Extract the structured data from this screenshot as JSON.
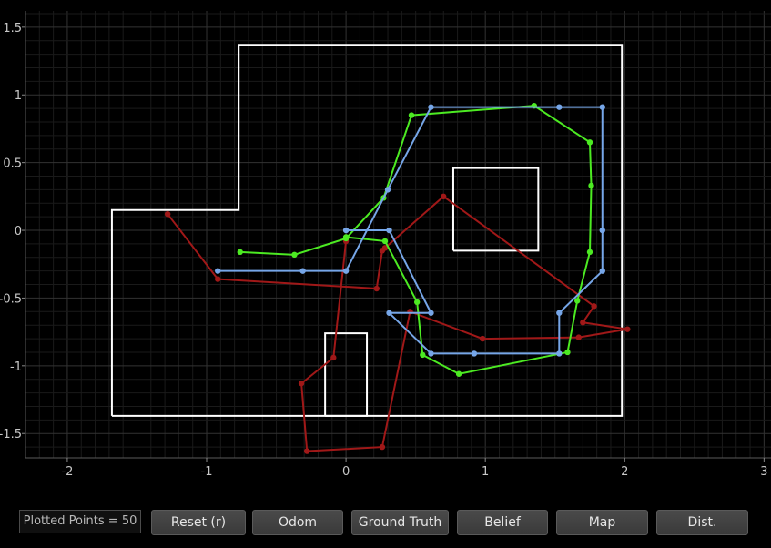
{
  "colors": {
    "background": "#000000",
    "grid_minor": "#1a1a1a",
    "grid_major": "#333333",
    "tick_text": "#c8c8c8",
    "map": "#ffffff",
    "odom": "#a01818",
    "ground_truth": "#4cea22",
    "belief": "#76a6e8"
  },
  "chart_data": {
    "type": "scatter",
    "xlim": [
      -2.3,
      3.05
    ],
    "ylim": [
      -1.68,
      1.62
    ],
    "x_ticks": [
      -2,
      -1,
      0,
      1,
      2,
      3
    ],
    "y_ticks": [
      1.5,
      1,
      0.5,
      0,
      -0.5,
      -1,
      -1.5
    ],
    "grid": true,
    "map_outline": [
      [
        [
          -1.68,
          -1.37
        ],
        [
          1.98,
          -1.37
        ],
        [
          1.98,
          1.37
        ],
        [
          -0.77,
          1.37
        ],
        [
          -0.77,
          0.15
        ],
        [
          -1.68,
          0.15
        ],
        [
          -1.68,
          -1.37
        ]
      ],
      [
        [
          0.77,
          -0.15
        ],
        [
          1.38,
          -0.15
        ],
        [
          1.38,
          0.46
        ],
        [
          0.77,
          0.46
        ],
        [
          0.77,
          -0.15
        ]
      ],
      [
        [
          -0.15,
          -1.37
        ],
        [
          0.15,
          -1.37
        ],
        [
          0.15,
          -0.76
        ],
        [
          -0.15,
          -0.76
        ],
        [
          -0.15,
          -1.37
        ]
      ]
    ],
    "series": [
      {
        "key": "odom",
        "points": [
          [
            -1.28,
            0.12
          ],
          [
            -0.92,
            -0.36
          ],
          [
            0.22,
            -0.43
          ],
          [
            0.26,
            -0.15
          ],
          [
            0.28,
            -0.13
          ],
          [
            0.7,
            0.25
          ],
          [
            1.78,
            -0.56
          ],
          [
            1.7,
            -0.68
          ],
          [
            2.02,
            -0.73
          ],
          [
            1.67,
            -0.79
          ],
          [
            0.98,
            -0.8
          ],
          [
            0.46,
            -0.6
          ],
          [
            0.26,
            -1.6
          ],
          [
            -0.28,
            -1.63
          ],
          [
            -0.32,
            -1.13
          ],
          [
            -0.09,
            -0.94
          ],
          [
            0.0,
            -0.08
          ]
        ]
      },
      {
        "key": "ground_truth",
        "points": [
          [
            -0.76,
            -0.16
          ],
          [
            -0.37,
            -0.18
          ],
          [
            0.0,
            -0.06
          ],
          [
            0.27,
            0.24
          ],
          [
            0.47,
            0.85
          ],
          [
            1.35,
            0.92
          ],
          [
            1.75,
            0.65
          ],
          [
            1.76,
            0.33
          ],
          [
            1.75,
            -0.16
          ],
          [
            1.66,
            -0.52
          ],
          [
            1.59,
            -0.9
          ],
          [
            0.81,
            -1.06
          ],
          [
            0.55,
            -0.92
          ],
          [
            0.51,
            -0.53
          ],
          [
            0.28,
            -0.08
          ],
          [
            0.0,
            -0.05
          ]
        ]
      },
      {
        "key": "belief",
        "points": [
          [
            -0.92,
            -0.3
          ],
          [
            -0.31,
            -0.3
          ],
          [
            0.0,
            -0.3
          ],
          [
            0.3,
            0.3
          ],
          [
            0.61,
            0.91
          ],
          [
            1.53,
            0.91
          ],
          [
            1.84,
            0.91
          ],
          [
            1.84,
            0.0
          ],
          [
            1.84,
            -0.3
          ],
          [
            1.53,
            -0.61
          ],
          [
            1.53,
            -0.91
          ],
          [
            0.92,
            -0.91
          ],
          [
            0.61,
            -0.91
          ],
          [
            0.31,
            -0.61
          ],
          [
            0.61,
            -0.61
          ],
          [
            0.31,
            0.0
          ],
          [
            0.0,
            0.0
          ]
        ]
      }
    ]
  },
  "toolbar": {
    "counter_label": "Plotted Points = 50",
    "buttons": [
      {
        "label": "Reset (r)"
      },
      {
        "label": "Odom"
      },
      {
        "label": "Ground Truth"
      },
      {
        "label": "Belief"
      },
      {
        "label": "Map"
      },
      {
        "label": "Dist."
      }
    ]
  }
}
